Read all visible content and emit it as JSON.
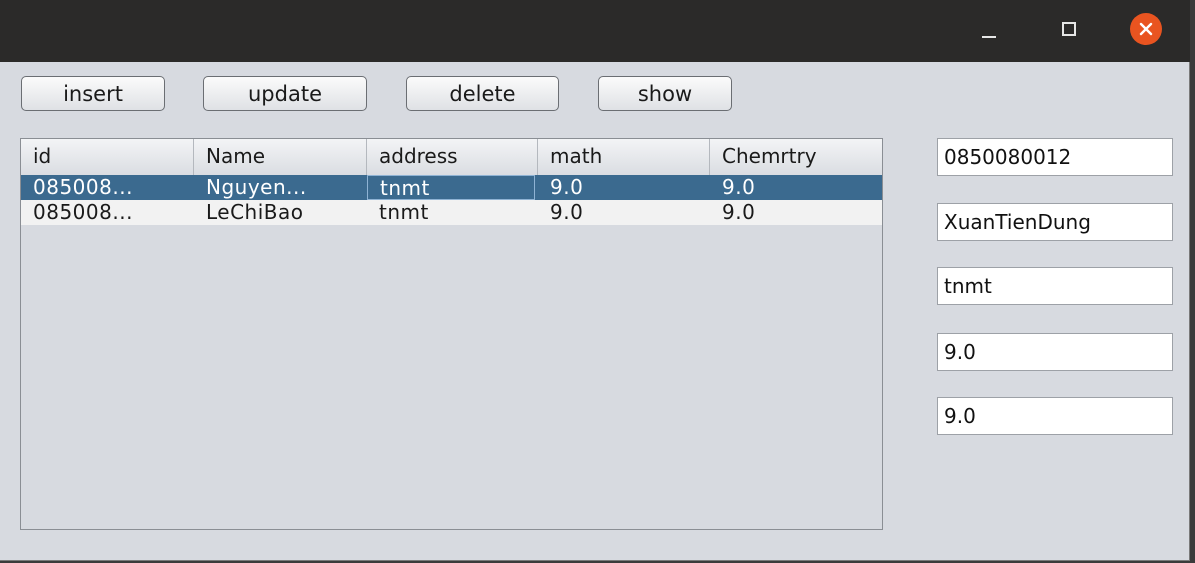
{
  "window": {
    "icons": {
      "minimize": "minimize-icon",
      "maximize": "maximize-icon",
      "close": "close-icon"
    },
    "close_color": "#e95420"
  },
  "toolbar": {
    "insert_label": "insert",
    "update_label": "update",
    "delete_label": "delete",
    "show_label": "show"
  },
  "table": {
    "columns": [
      "id",
      "Name",
      "address",
      "math",
      "Chemrtry"
    ],
    "rows": [
      {
        "id": "085008...",
        "name": "Nguyen...",
        "address": "tnmt",
        "math": "9.0",
        "chem": "9.0",
        "selected": true
      },
      {
        "id": "085008...",
        "name": "LeChiBao",
        "address": "tnmt",
        "math": "9.0",
        "chem": "9.0",
        "selected": false
      }
    ],
    "selection_color": "#3b6a8f"
  },
  "form": {
    "id_value": "0850080012",
    "name_value": "XuanTienDung",
    "address_value": "tnmt",
    "math_value": "9.0",
    "chem_value": "9.0"
  }
}
